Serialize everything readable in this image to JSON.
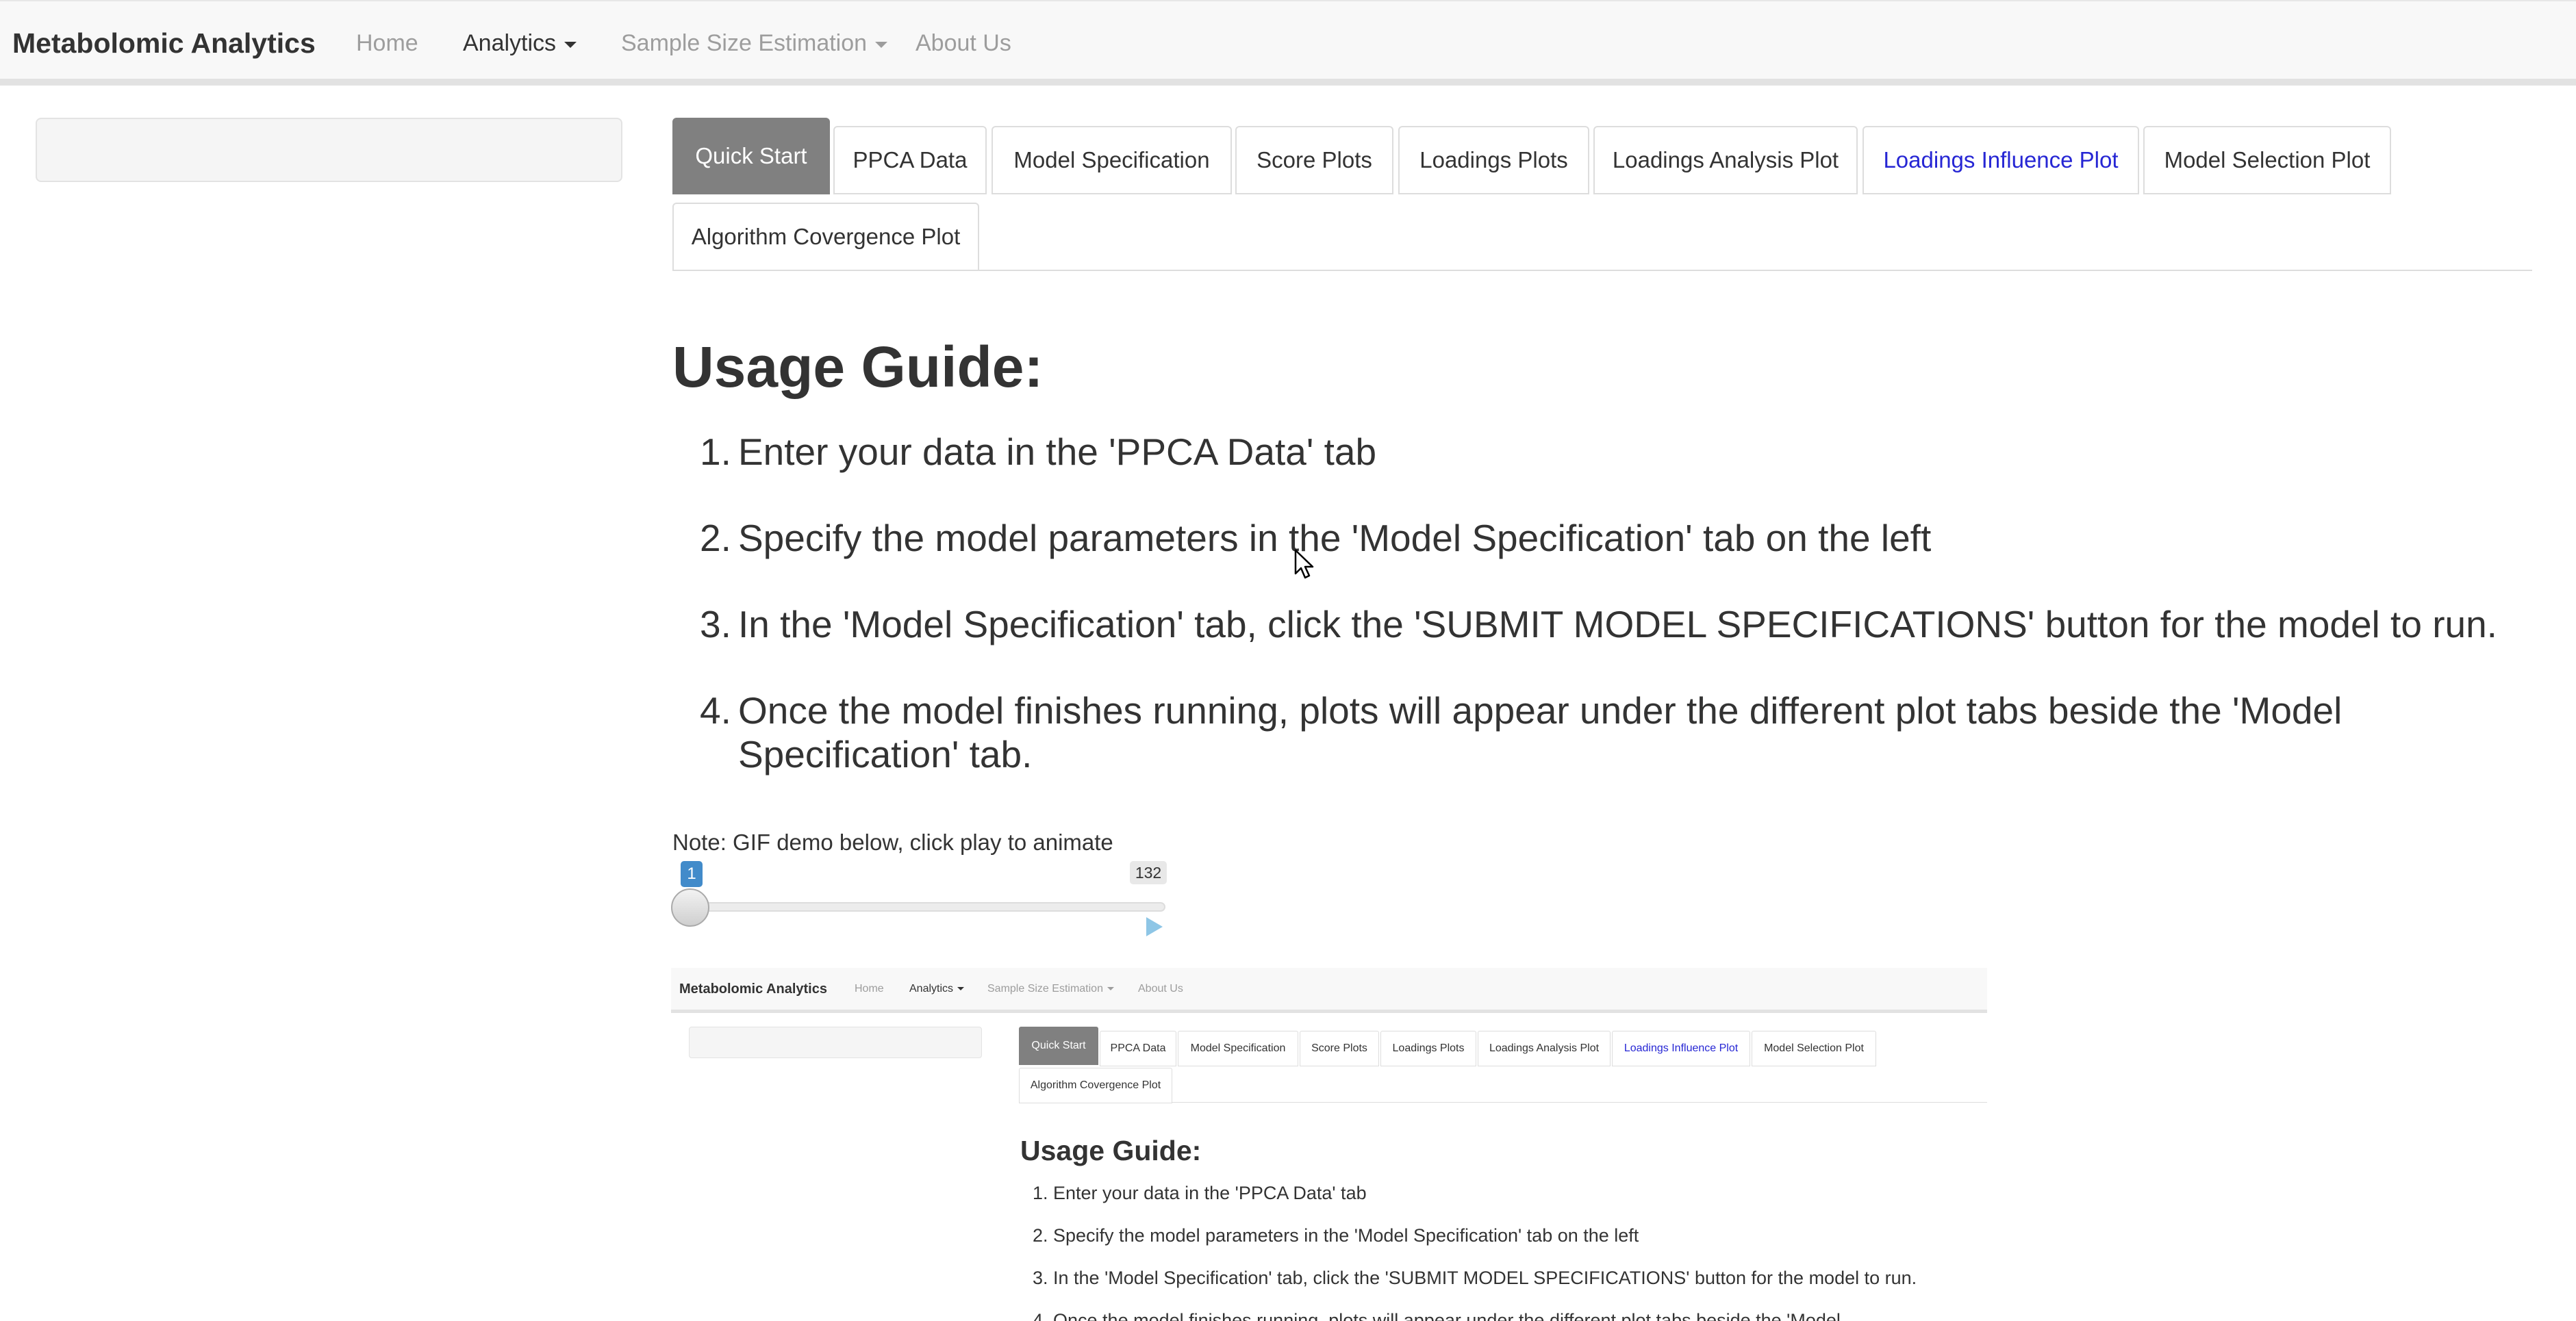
{
  "navbar": {
    "brand": "Metabolomic Analytics",
    "items": [
      {
        "label": "Home"
      },
      {
        "label": "Analytics"
      },
      {
        "label": "Sample Size Estimation"
      },
      {
        "label": "About Us"
      }
    ]
  },
  "tabs": [
    {
      "label": "Quick Start"
    },
    {
      "label": "PPCA Data"
    },
    {
      "label": "Model Specification"
    },
    {
      "label": "Score Plots"
    },
    {
      "label": "Loadings Plots"
    },
    {
      "label": "Loadings Analysis Plot"
    },
    {
      "label": "Loadings Influence Plot"
    },
    {
      "label": "Model Selection Plot"
    },
    {
      "label": "Algorithm Covergence Plot"
    }
  ],
  "main": {
    "title": "Usage Guide:",
    "steps": [
      {
        "num": "1.",
        "text": "Enter your data in the 'PPCA Data' tab"
      },
      {
        "num": "2.",
        "text": "Specify the model parameters in the 'Model Specification' tab on the left"
      },
      {
        "num": "3.",
        "text": "In the 'Model Specification' tab, click the 'SUBMIT MODEL SPECIFICATIONS' button for the model to run."
      },
      {
        "num": "4.",
        "text": "Once the model finishes running, plots will appear under the different plot tabs beside the 'Model Specification' tab."
      }
    ],
    "note": "Note: GIF demo below, click play to animate"
  },
  "slider": {
    "min": "1",
    "max": "132",
    "value": 1
  },
  "gif": {
    "brand": "Metabolomic Analytics",
    "nav": [
      "Home",
      "Analytics",
      "Sample Size Estimation",
      "About Us"
    ],
    "tabs": [
      "Quick Start",
      "PPCA Data",
      "Model Specification",
      "Score Plots",
      "Loadings Plots",
      "Loadings Analysis Plot",
      "Loadings Influence Plot",
      "Model Selection Plot",
      "Algorithm Covergence Plot"
    ],
    "title": "Usage Guide:",
    "steps": [
      "1. Enter your data in the 'PPCA Data' tab",
      "2. Specify the model parameters in the 'Model Specification' tab on the left",
      "3. In the 'Model Specification' tab, click the 'SUBMIT MODEL SPECIFICATIONS' button for the model to run.",
      "4. Once the model finishes running, plots will appear under the different plot tabs beside the 'Model"
    ]
  },
  "colors": {
    "active_tab_bg": "#808080",
    "highlight_tab_text": "#2626d4",
    "slider_accent": "#428bca",
    "play_icon": "#8ec6e6"
  }
}
